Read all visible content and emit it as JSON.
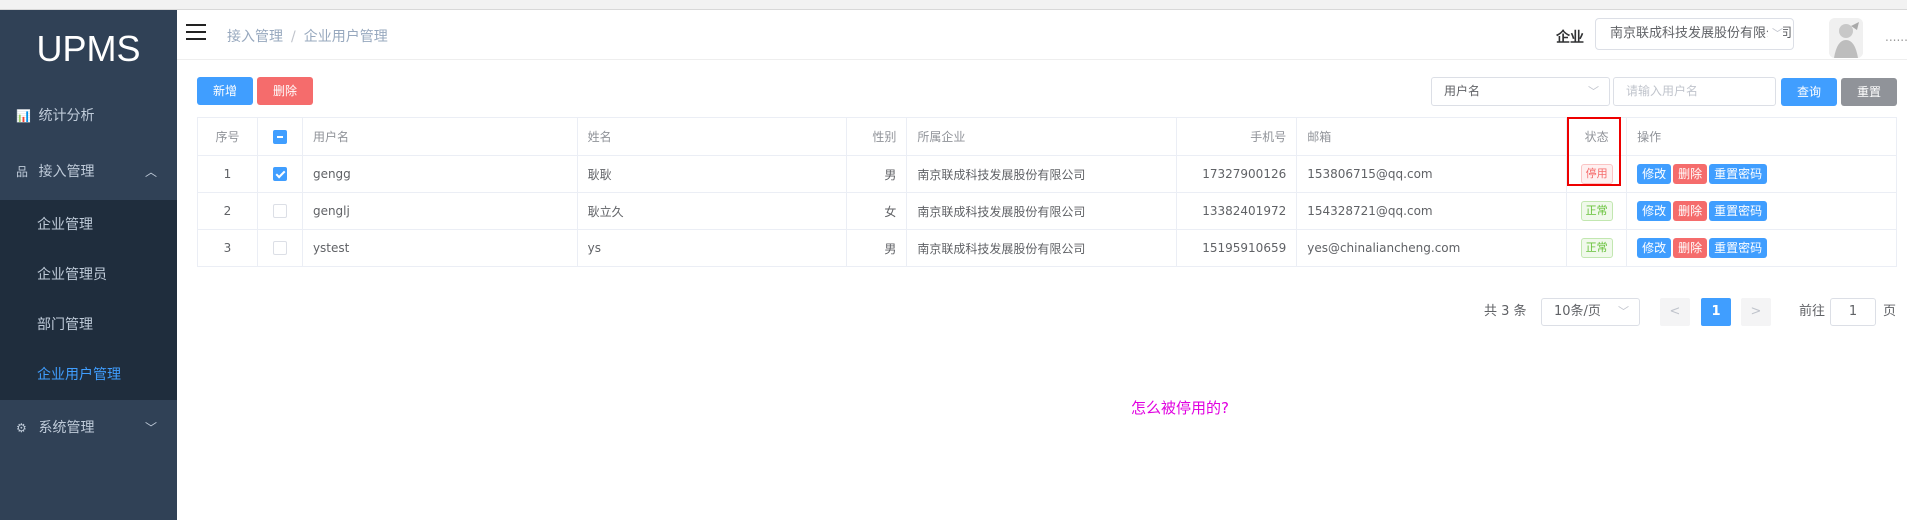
{
  "app": {
    "logo": "UPMS"
  },
  "sidebar": {
    "items": [
      {
        "icon": "bar-chart-icon",
        "label": "统计分析"
      },
      {
        "icon": "sitemap-icon",
        "label": "接入管理",
        "expanded": true,
        "children": [
          {
            "label": "企业管理"
          },
          {
            "label": "企业管理员"
          },
          {
            "label": "部门管理"
          },
          {
            "label": "企业用户管理",
            "active": true
          }
        ]
      },
      {
        "icon": "gears-icon",
        "label": "系统管理"
      }
    ]
  },
  "header": {
    "breadcrumb": [
      "接入管理",
      "企业用户管理"
    ],
    "breadcrumb_sep": "/",
    "enterprise_label": "企业",
    "enterprise_value": "南京联成科技发展股份有限公司",
    "user_menu": "......"
  },
  "toolbar": {
    "add_label": "新增",
    "delete_label": "删除",
    "search_field_value": "用户名",
    "search_placeholder": "请输入用户名",
    "query_label": "查询",
    "reset_label": "重置"
  },
  "table": {
    "headers": {
      "index": "序号",
      "username": "用户名",
      "name": "姓名",
      "gender": "性别",
      "company": "所属企业",
      "phone": "手机号",
      "email": "邮箱",
      "status": "状态",
      "actions": "操作"
    },
    "action_labels": {
      "edit": "修改",
      "delete": "删除",
      "reset_password": "重置密码"
    },
    "rows": [
      {
        "index": "1",
        "checked": true,
        "username": "gengg",
        "name": "耿耿",
        "gender": "男",
        "company": "南京联成科技发展股份有限公司",
        "phone": "17327900126",
        "email": "153806715@qq.com",
        "status": "停用"
      },
      {
        "index": "2",
        "checked": false,
        "username": "genglj",
        "name": "耿立久",
        "gender": "女",
        "company": "南京联成科技发展股份有限公司",
        "phone": "13382401972",
        "email": "154328721@qq.com",
        "status": "正常"
      },
      {
        "index": "3",
        "checked": false,
        "username": "ystest",
        "name": "ys",
        "gender": "男",
        "company": "南京联成科技发展股份有限公司",
        "phone": "15195910659",
        "email": "yes@chinaliancheng.com",
        "status": "正常"
      }
    ]
  },
  "pagination": {
    "total": "共 3 条",
    "page_size": "10条/页",
    "current_page": "1",
    "goto_label": "前往",
    "goto_value": "1",
    "page_suffix": "页"
  },
  "annotation": {
    "text": "怎么被停用的?"
  },
  "colors": {
    "primary": "#409eff",
    "danger": "#f56c6c",
    "sidebar_bg": "#304156",
    "annotation": "#e000e0",
    "highlight": "#ee0000"
  }
}
